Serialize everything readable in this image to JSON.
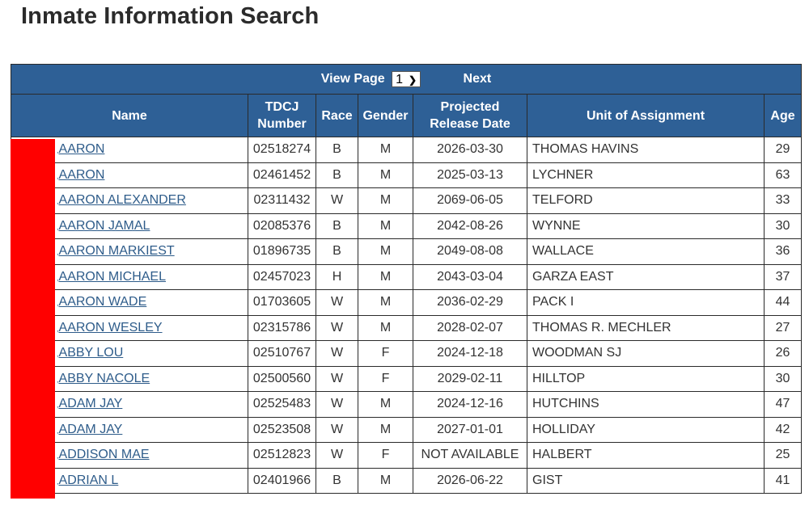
{
  "page": {
    "title": "Inmate Information Search"
  },
  "pager": {
    "view_page_label": "View Page",
    "selected_page": "1",
    "next_label": "Next"
  },
  "table": {
    "headers": {
      "name": "Name",
      "tdcj_number": "TDCJ Number",
      "race": "Race",
      "gender": "Gender",
      "projected_release_date": "Projected Release Date",
      "unit_of_assignment": "Unit of Assignment",
      "age": "Age"
    },
    "rows": [
      {
        "name": "AARON",
        "tdcj": "02518274",
        "race": "B",
        "gender": "M",
        "release": "2026-03-30",
        "unit": "THOMAS HAVINS",
        "age": "29"
      },
      {
        "name": "AARON",
        "tdcj": "02461452",
        "race": "B",
        "gender": "M",
        "release": "2025-03-13",
        "unit": "LYCHNER",
        "age": "63"
      },
      {
        "name": "AARON ALEXANDER",
        "tdcj": "02311432",
        "race": "W",
        "gender": "M",
        "release": "2069-06-05",
        "unit": "TELFORD",
        "age": "33"
      },
      {
        "name": "AARON JAMAL",
        "tdcj": "02085376",
        "race": "B",
        "gender": "M",
        "release": "2042-08-26",
        "unit": "WYNNE",
        "age": "30"
      },
      {
        "name": "AARON MARKIEST",
        "tdcj": "01896735",
        "race": "B",
        "gender": "M",
        "release": "2049-08-08",
        "unit": "WALLACE",
        "age": "36"
      },
      {
        "name": "AARON MICHAEL",
        "tdcj": "02457023",
        "race": "H",
        "gender": "M",
        "release": "2043-03-04",
        "unit": "GARZA EAST",
        "age": "37"
      },
      {
        "name": "AARON WADE",
        "tdcj": "01703605",
        "race": "W",
        "gender": "M",
        "release": "2036-02-29",
        "unit": "PACK I",
        "age": "44"
      },
      {
        "name": "AARON WESLEY",
        "tdcj": "02315786",
        "race": "W",
        "gender": "M",
        "release": "2028-02-07",
        "unit": "THOMAS R. MECHLER",
        "age": "27"
      },
      {
        "name": "ABBY LOU",
        "tdcj": "02510767",
        "race": "W",
        "gender": "F",
        "release": "2024-12-18",
        "unit": "WOODMAN SJ",
        "age": "26"
      },
      {
        "name": "ABBY NACOLE",
        "tdcj": "02500560",
        "race": "W",
        "gender": "F",
        "release": "2029-02-11",
        "unit": "HILLTOP",
        "age": "30"
      },
      {
        "name": "ADAM JAY",
        "tdcj": "02525483",
        "race": "W",
        "gender": "M",
        "release": "2024-12-16",
        "unit": "HUTCHINS",
        "age": "47"
      },
      {
        "name": "ADAM JAY",
        "tdcj": "02523508",
        "race": "W",
        "gender": "M",
        "release": "2027-01-01",
        "unit": "HOLLIDAY",
        "age": "42"
      },
      {
        "name": "ADDISON MAE",
        "tdcj": "02512823",
        "race": "W",
        "gender": "F",
        "release": "NOT AVAILABLE",
        "unit": "HALBERT",
        "age": "25"
      },
      {
        "name": "ADRIAN L",
        "tdcj": "02401966",
        "race": "B",
        "gender": "M",
        "release": "2026-06-22",
        "unit": "GIST",
        "age": "41"
      }
    ]
  }
}
